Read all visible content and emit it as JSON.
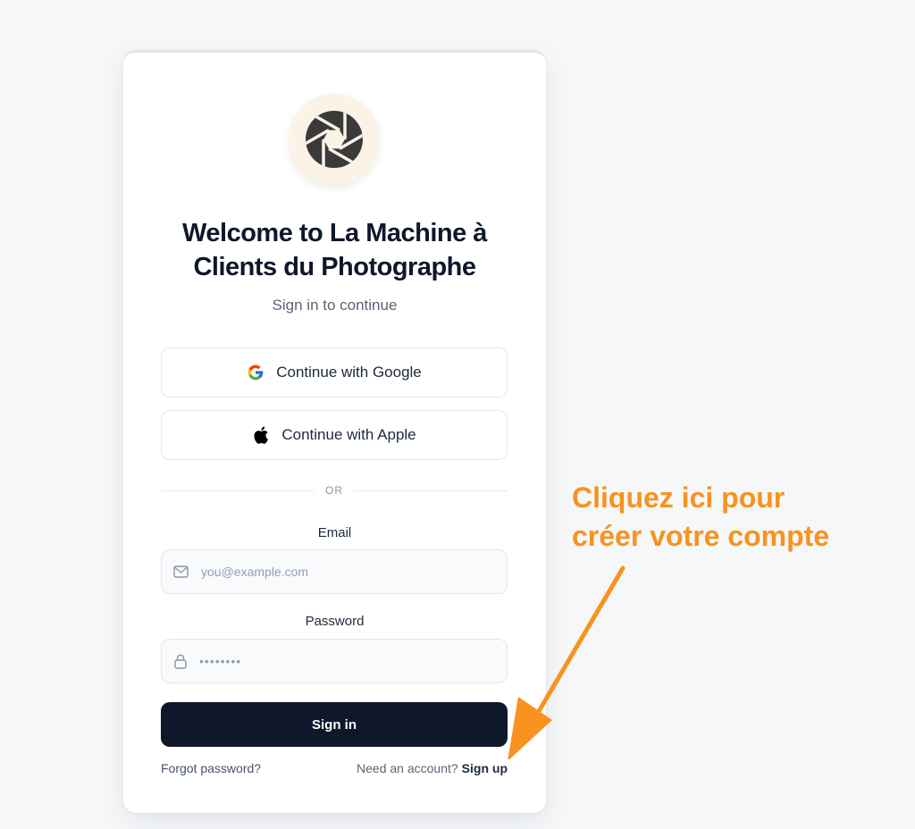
{
  "card": {
    "title_line1": "Welcome to La Machine à",
    "title_line2": "Clients du Photographe",
    "subtitle": "Sign in to continue",
    "google_button": "Continue with Google",
    "apple_button": "Continue with Apple",
    "divider": "OR",
    "email_label": "Email",
    "email_placeholder": "you@example.com",
    "password_label": "Password",
    "password_value": "••••••••",
    "signin_button": "Sign in",
    "forgot_password": "Forgot password?",
    "need_account": "Need an account?",
    "signup_link": "Sign up"
  },
  "icons": {
    "logo": "camera-aperture-icon",
    "google": "google-icon",
    "apple": "apple-icon",
    "email": "mail-icon",
    "password": "lock-icon"
  },
  "annotation": {
    "line1": "Cliquez ici pour",
    "line2": "créer votre compte"
  },
  "colors": {
    "accent": "#f7931e",
    "primary_button": "#0f172a",
    "logo_bg": "#fbf4e6"
  }
}
